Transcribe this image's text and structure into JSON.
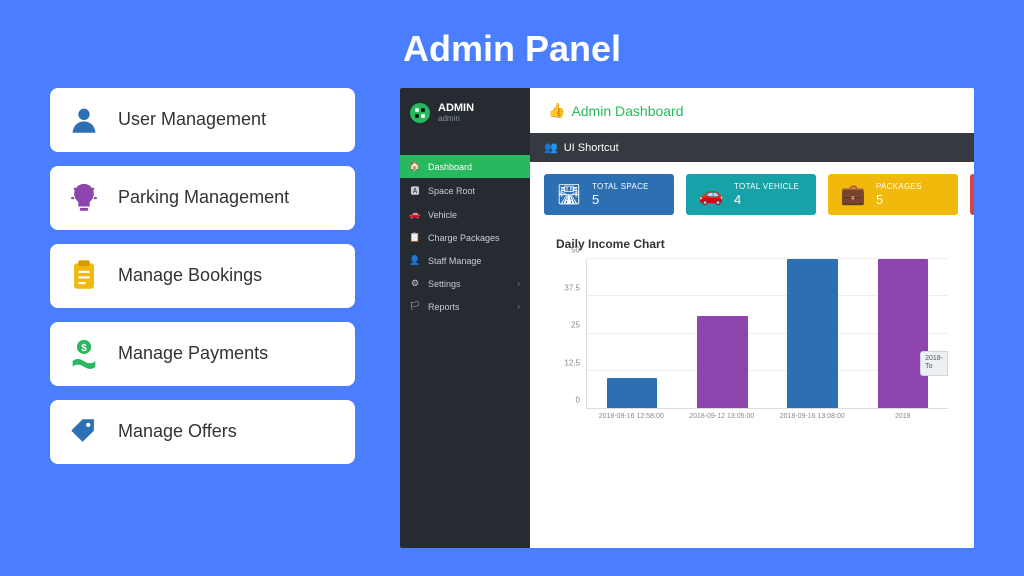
{
  "page_title": "Admin Panel",
  "left_cards": [
    {
      "label": "User Management",
      "icon": "user"
    },
    {
      "label": "Parking Management",
      "icon": "bulb"
    },
    {
      "label": "Manage Bookings",
      "icon": "clipboard"
    },
    {
      "label": "Manage Payments",
      "icon": "money"
    },
    {
      "label": "Manage Offers",
      "icon": "tag"
    }
  ],
  "dashboard": {
    "admin_label": "ADMIN",
    "admin_sub": "admin",
    "nav": [
      {
        "label": "Dashboard",
        "active": true
      },
      {
        "label": "Space Root"
      },
      {
        "label": "Vehicle"
      },
      {
        "label": "Charge Packages"
      },
      {
        "label": "Staff Manage"
      },
      {
        "label": "Settings",
        "chevron": true
      },
      {
        "label": "Reports",
        "chevron": true
      }
    ],
    "main_title": "Admin Dashboard",
    "shortcut_title": "UI Shortcut",
    "stats": [
      {
        "color": "blue",
        "label": "TOTAL SPACE",
        "value": "5"
      },
      {
        "color": "teal",
        "label": "TOTAL VEHICLE",
        "value": "4"
      },
      {
        "color": "yellow",
        "label": "PACKAGES",
        "value": "5"
      },
      {
        "color": "red",
        "label": "",
        "value": ""
      }
    ],
    "tooltip": {
      "line1": "2018-",
      "line2": "To"
    }
  },
  "chart_data": {
    "type": "bar",
    "title": "Daily Income Chart",
    "xlabel": "",
    "ylabel": "",
    "ylim": [
      0,
      50
    ],
    "y_ticks": [
      0,
      12.5,
      25,
      37.5,
      50
    ],
    "categories": [
      "2018-09-16 12:58:00",
      "2018-09-12 13:05:00",
      "2018-09-16 13:08:00",
      "2018"
    ],
    "values": [
      10,
      31,
      50,
      50
    ],
    "bar_colors": [
      "#2c6fb3",
      "#8e44ad",
      "#2c6fb3",
      "#8e44ad"
    ]
  }
}
